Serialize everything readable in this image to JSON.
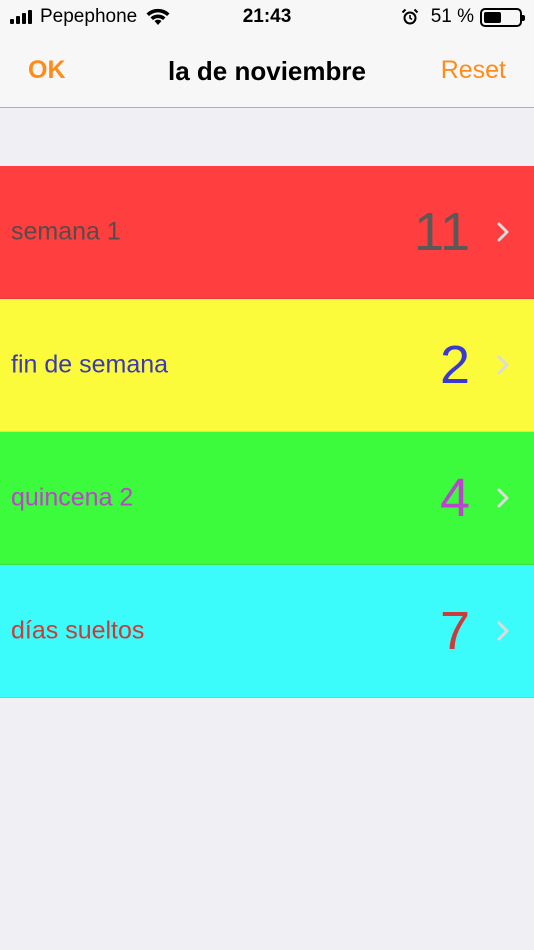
{
  "status_bar": {
    "carrier": "Pepephone",
    "time": "21:43",
    "battery_text": "51 %",
    "battery_level": 0.51
  },
  "nav": {
    "left_label": "OK",
    "title": "la de noviembre",
    "right_label": "Reset",
    "accent_color": "#ff8c1a"
  },
  "rows": [
    {
      "label": "semana 1",
      "count": "11",
      "bg_color": "#fe3e3f",
      "label_color": "#5a4a4a",
      "count_color": "#5c5858",
      "icon": "chevron-right-icon"
    },
    {
      "label": "fin de semana",
      "count": "2",
      "bg_color": "#fbfb3c",
      "label_color": "#3a3ab6",
      "count_color": "#3a3ad0",
      "icon": "chevron-right-icon"
    },
    {
      "label": "quincena 2",
      "count": "4",
      "bg_color": "#3cfb3c",
      "label_color": "#bb44cc",
      "count_color": "#bb44cc",
      "icon": "chevron-right-icon"
    },
    {
      "label": "días sueltos",
      "count": "7",
      "bg_color": "#3cfbfb",
      "label_color": "#c83c3c",
      "count_color": "#c83c3c",
      "icon": "chevron-right-icon"
    }
  ]
}
